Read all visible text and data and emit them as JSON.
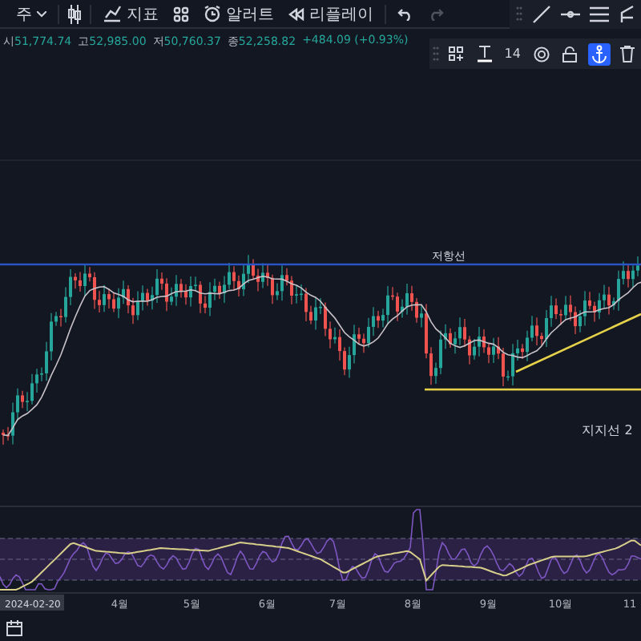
{
  "toolbar": {
    "timeframe": "주",
    "items": [
      {
        "kind": "indicators",
        "label": "지표"
      },
      {
        "kind": "layouts"
      },
      {
        "kind": "alert",
        "label": "알러트"
      },
      {
        "kind": "replay",
        "label": "리플레이"
      },
      {
        "kind": "undo"
      },
      {
        "kind": "redo",
        "disabled": true
      }
    ]
  },
  "legend": {
    "values": [
      {
        "label": "시",
        "value": "51,774.74"
      },
      {
        "label": "고",
        "value": "52,985.00"
      },
      {
        "label": "저",
        "value": "50,760.37"
      },
      {
        "label": "종",
        "value": "52,258.82"
      }
    ],
    "change": "+484.09 (+0.93%)"
  },
  "drawing_toolbar": {
    "font_size": "14",
    "anchor_selected": true
  },
  "drawings": [
    {
      "kind": "horizontal",
      "label": "저항선",
      "color": "#2a55c8"
    },
    {
      "kind": "support",
      "label": "지지선 2",
      "color": "#e6d24a"
    }
  ],
  "time_axis": {
    "current_date": "2024-02-20",
    "months": [
      "4월",
      "5월",
      "6월",
      "7월",
      "8월",
      "9월",
      "10월",
      "11"
    ]
  }
}
